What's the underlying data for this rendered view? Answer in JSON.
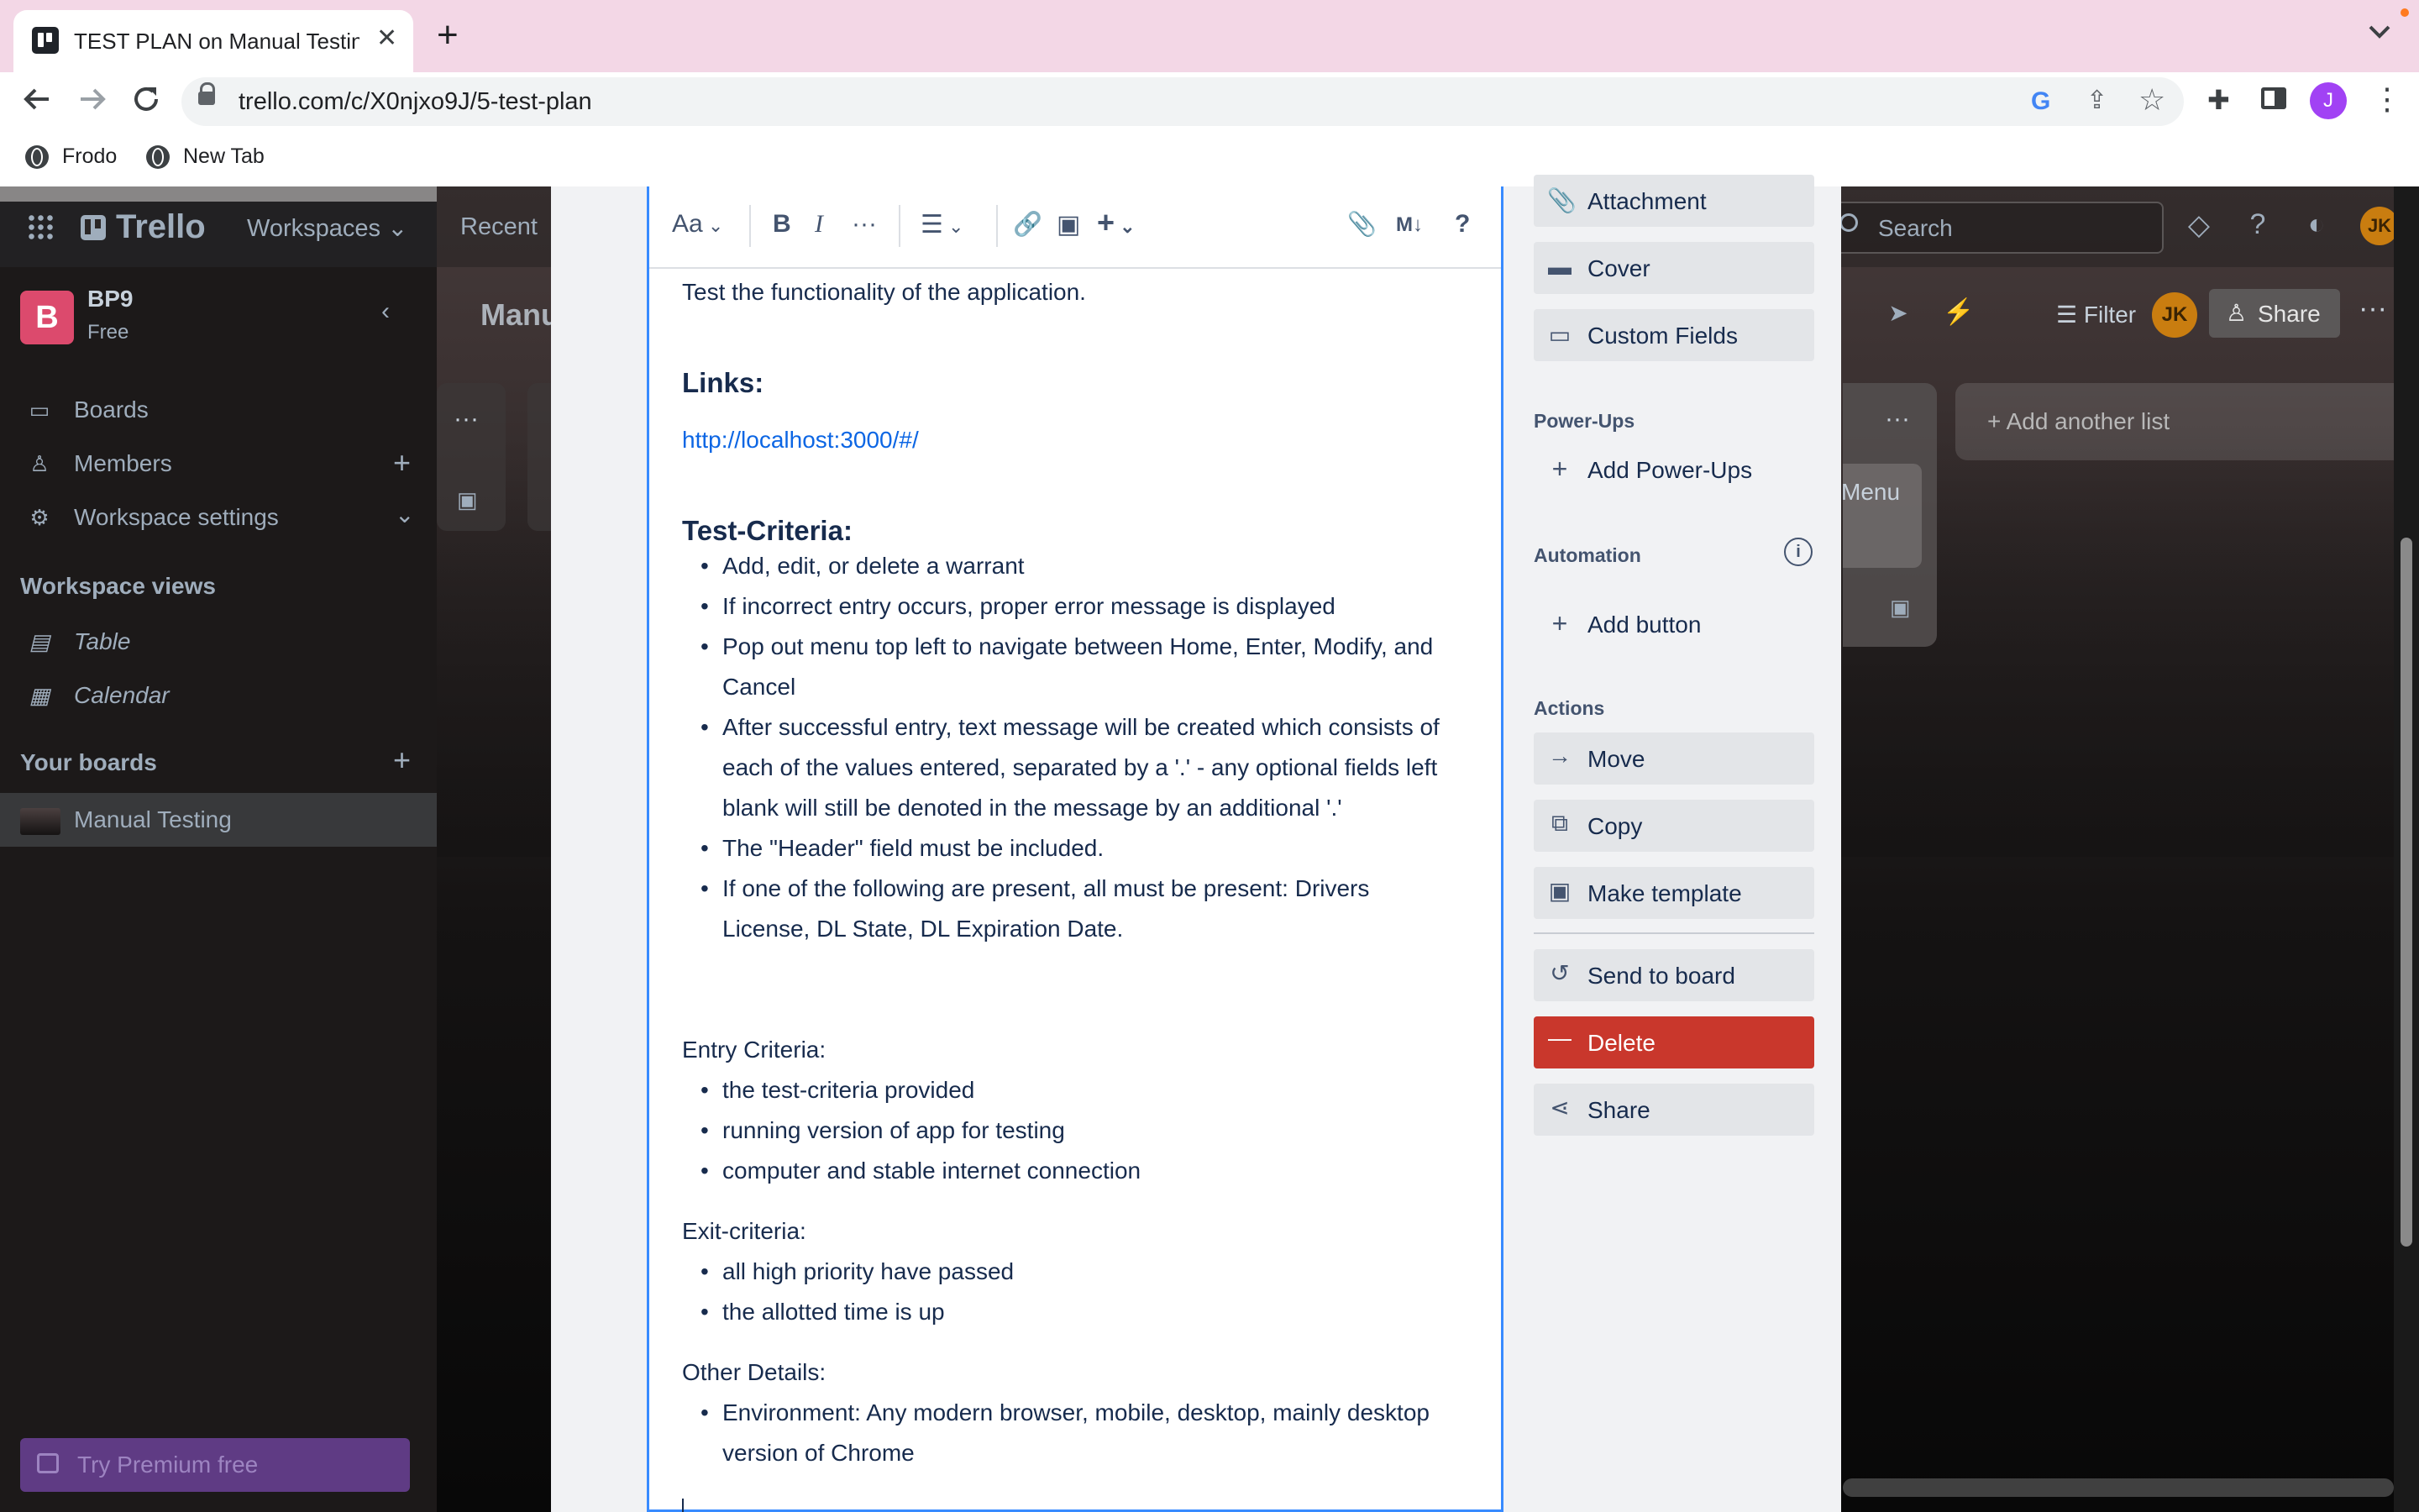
{
  "browser": {
    "tab_title": "TEST PLAN on Manual Testing | Trello",
    "tab_close": "✕",
    "new_tab": "+",
    "url": "trello.com/c/X0njxo9J/5-test-plan",
    "profile_initial": "J",
    "bookmarks": [
      {
        "label": "Frodo",
        "icon": "globe-icon"
      },
      {
        "label": "New Tab",
        "icon": "globe-icon"
      }
    ],
    "accent_tabstrip": "#f3d7e6"
  },
  "trello": {
    "logo": "Trello",
    "header": {
      "workspaces": "Workspaces",
      "recent": "Recent",
      "search_placeholder": "Search",
      "avatar": "JK"
    },
    "sidebar": {
      "workspace_badge": "B",
      "workspace_name": "BP9",
      "workspace_plan": "Free",
      "items": [
        {
          "label": "Boards",
          "icon": "board-icon"
        },
        {
          "label": "Members",
          "icon": "person-icon"
        },
        {
          "label": "Workspace settings",
          "icon": "gear-icon"
        }
      ],
      "views_heading": "Workspace views",
      "views": [
        {
          "label": "Table",
          "icon": "table-icon"
        },
        {
          "label": "Calendar",
          "icon": "calendar-icon"
        }
      ],
      "boards_heading": "Your boards",
      "boards": [
        {
          "label": "Manual Testing"
        }
      ],
      "premium": "Try Premium free"
    },
    "board": {
      "title": "Manu",
      "filter": "Filter",
      "share": "Share",
      "member": "JK",
      "list_menu": "···",
      "right_card_text": "Menu",
      "add_list": "+ Add another list"
    }
  },
  "card": {
    "toolbar": {
      "text_style": "Aa",
      "bold": "B",
      "italic": "I",
      "more": "···",
      "list": "☰",
      "link": "🔗",
      "image": "▣",
      "insert": "+",
      "attach": "📎",
      "markdown": "M↓",
      "help": "?"
    },
    "description": {
      "intro": "Test the functionality of the application.",
      "links_heading": "Links:",
      "link": "http://localhost:3000/#/",
      "criteria_heading": "Test-Criteria:",
      "criteria": [
        "Add, edit, or delete a warrant",
        "If incorrect entry occurs, proper error message is displayed",
        "Pop out menu top left to navigate between Home, Enter, Modify, and Cancel",
        "After successful entry, text message will be created which consists of each of the values entered, separated by a '.' - any optional fields left blank will still be denoted in the message by an additional '.'",
        "The \"Header\" field must be included.",
        "If one of the following are present, all must be present: Drivers License, DL State, DL Expiration Date."
      ],
      "entry_heading": "Entry Criteria:",
      "entry": [
        "the test-criteria provided",
        "running version of app for testing",
        "computer and stable internet connection"
      ],
      "exit_heading": "Exit-criteria:",
      "exit": [
        "all high priority have passed",
        "the allotted time is up"
      ],
      "other_heading": "Other Details:",
      "other": [
        "Environment: Any modern browser, mobile, desktop, mainly desktop version of Chrome"
      ]
    },
    "actions": {
      "add_to_card": [
        {
          "label": "Attachment",
          "icon": "paperclip-icon"
        },
        {
          "label": "Cover",
          "icon": "cover-icon"
        },
        {
          "label": "Custom Fields",
          "icon": "custom-fields-icon"
        }
      ],
      "powerups_heading": "Power-Ups",
      "add_powerups": "Add Power-Ups",
      "automation_heading": "Automation",
      "add_button": "Add button",
      "actions_heading": "Actions",
      "list": [
        {
          "label": "Move",
          "icon": "arrow-right-icon"
        },
        {
          "label": "Copy",
          "icon": "copy-icon"
        },
        {
          "label": "Make template",
          "icon": "template-icon"
        }
      ],
      "send_to_board": "Send to board",
      "delete": "Delete",
      "share": "Share",
      "delete_color": "#c9372c"
    }
  }
}
